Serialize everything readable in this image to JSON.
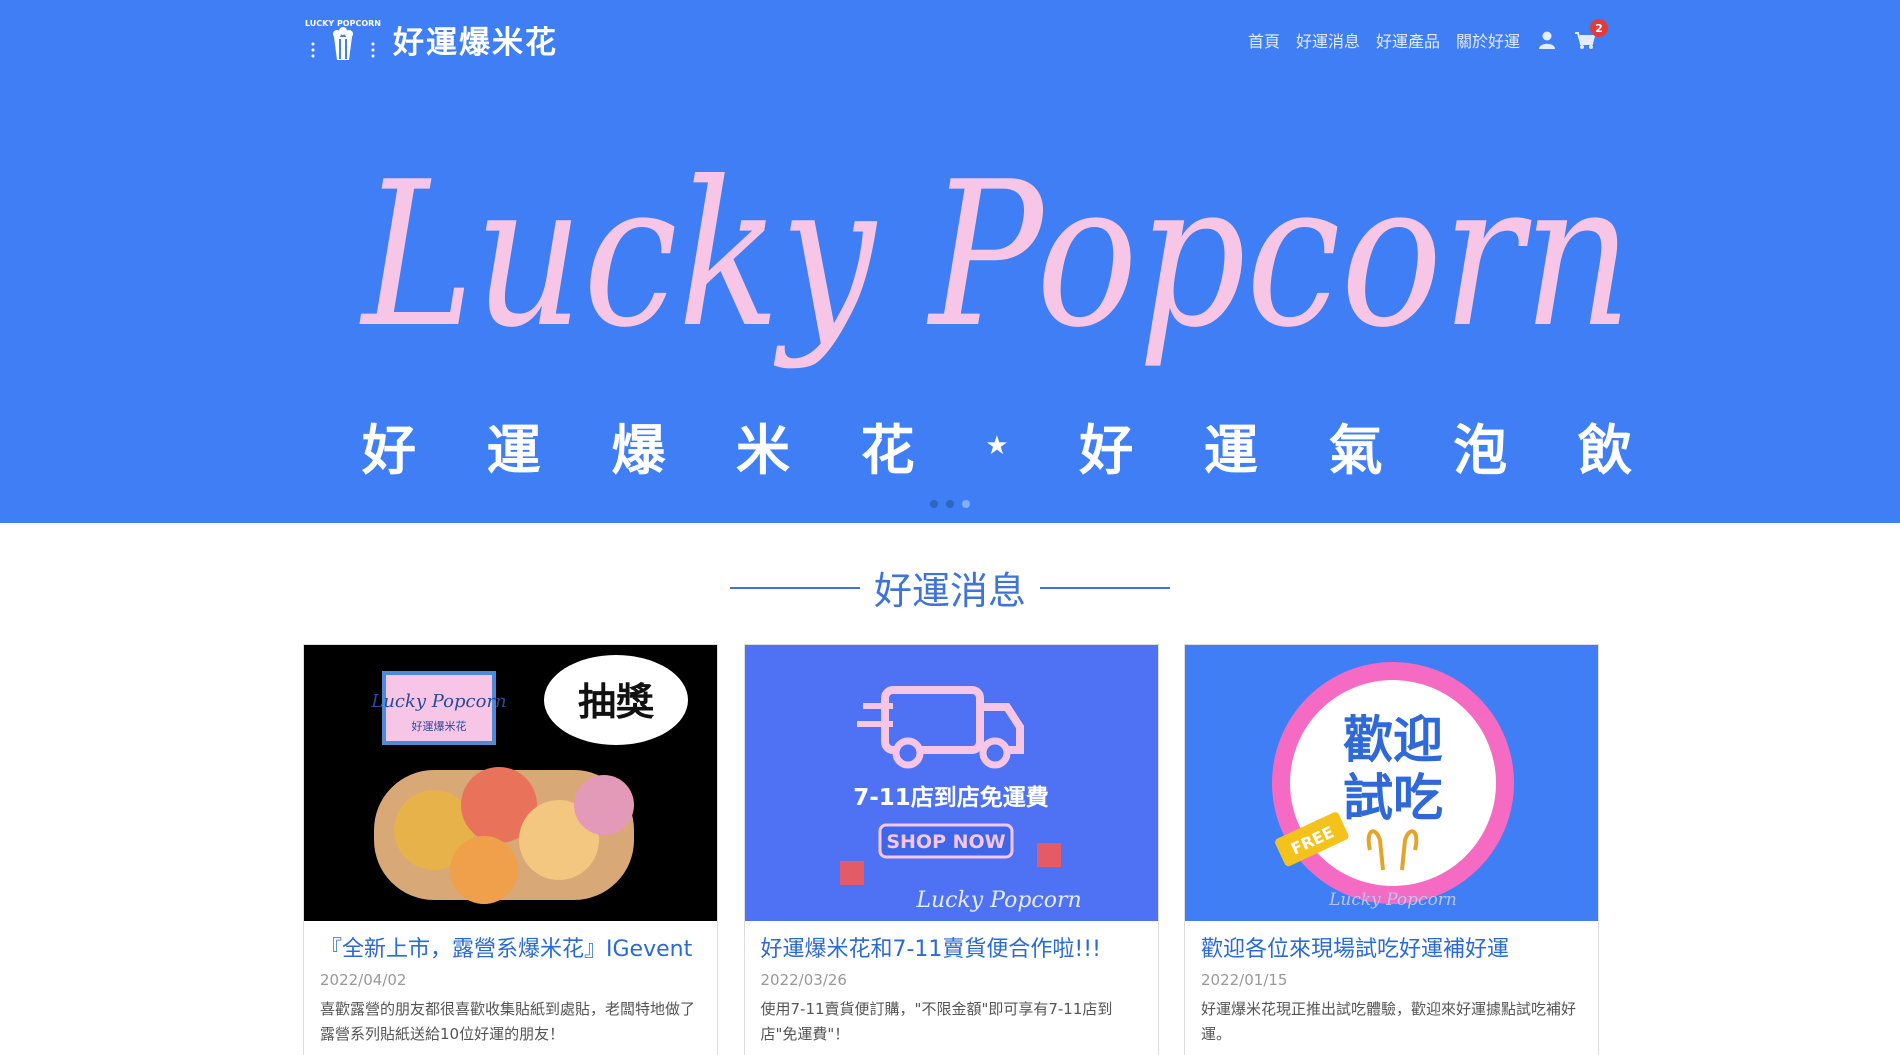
{
  "brand": {
    "name": "好運爆米花",
    "logo_text": "LUCKY POPCORN"
  },
  "nav": {
    "items": [
      "首頁",
      "好運消息",
      "好運產品",
      "關於好運"
    ],
    "cart_count": "2"
  },
  "hero": {
    "script_title": "Lucky Popcorn",
    "subtitle": [
      "好",
      "運",
      "爆",
      "米",
      "花",
      "★",
      "好",
      "運",
      "氣",
      "泡",
      "飲"
    ],
    "active_slide": 3,
    "slide_count": 3
  },
  "section": {
    "title": "好運消息"
  },
  "news": [
    {
      "title": "『全新上市，露營系爆米花』IGevent",
      "date": "2022/04/02",
      "text": "喜歡露營的朋友都很喜歡收集貼紙到處貼，老闆特地做了露營系列貼紙送給10位好運的朋友！",
      "img_logo": "Lucky Popcorn",
      "img_logo_sub": "好運爆米花",
      "img_badge": "抽獎"
    },
    {
      "title": "好運爆米花和7-11賣貨便合作啦!!!",
      "date": "2022/03/26",
      "text": "使用7-11賣貨便訂購，\"不限金額\"即可享有7-11店到店\"免運費\"！",
      "img_caption": "7-11店到店免運費",
      "img_button": "SHOP NOW",
      "img_logo": "Lucky Popcorn"
    },
    {
      "title": "歡迎各位來現場試吃好運補好運",
      "date": "2022/01/15",
      "text": "好運爆米花現正推出試吃體驗，歡迎來好運據點試吃補好運。",
      "img_line1": "歡迎",
      "img_line2": "試吃",
      "img_tag": "FREE",
      "img_logo": "Lucky Popcorn"
    }
  ],
  "colors": {
    "brand_blue": "#3f7ef5",
    "hero_pink": "#f7c6e6",
    "title_blue": "#3f73d8"
  }
}
